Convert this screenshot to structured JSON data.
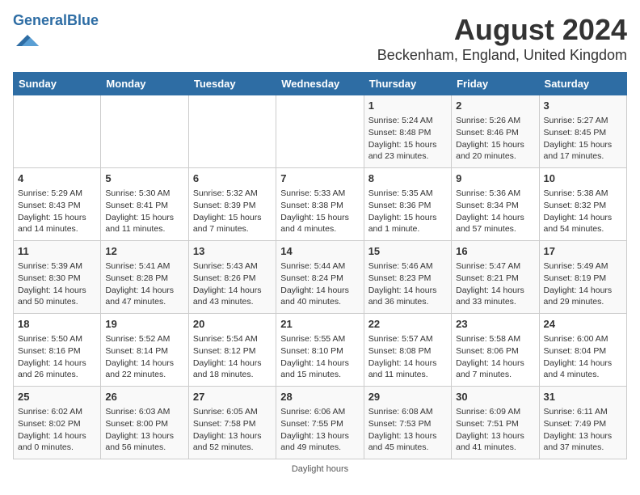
{
  "header": {
    "logo_general": "General",
    "logo_blue": "Blue",
    "main_title": "August 2024",
    "subtitle": "Beckenham, England, United Kingdom"
  },
  "columns": [
    "Sunday",
    "Monday",
    "Tuesday",
    "Wednesday",
    "Thursday",
    "Friday",
    "Saturday"
  ],
  "weeks": [
    [
      {
        "day": "",
        "info": ""
      },
      {
        "day": "",
        "info": ""
      },
      {
        "day": "",
        "info": ""
      },
      {
        "day": "",
        "info": ""
      },
      {
        "day": "1",
        "info": "Sunrise: 5:24 AM\nSunset: 8:48 PM\nDaylight: 15 hours\nand 23 minutes."
      },
      {
        "day": "2",
        "info": "Sunrise: 5:26 AM\nSunset: 8:46 PM\nDaylight: 15 hours\nand 20 minutes."
      },
      {
        "day": "3",
        "info": "Sunrise: 5:27 AM\nSunset: 8:45 PM\nDaylight: 15 hours\nand 17 minutes."
      }
    ],
    [
      {
        "day": "4",
        "info": "Sunrise: 5:29 AM\nSunset: 8:43 PM\nDaylight: 15 hours\nand 14 minutes."
      },
      {
        "day": "5",
        "info": "Sunrise: 5:30 AM\nSunset: 8:41 PM\nDaylight: 15 hours\nand 11 minutes."
      },
      {
        "day": "6",
        "info": "Sunrise: 5:32 AM\nSunset: 8:39 PM\nDaylight: 15 hours\nand 7 minutes."
      },
      {
        "day": "7",
        "info": "Sunrise: 5:33 AM\nSunset: 8:38 PM\nDaylight: 15 hours\nand 4 minutes."
      },
      {
        "day": "8",
        "info": "Sunrise: 5:35 AM\nSunset: 8:36 PM\nDaylight: 15 hours\nand 1 minute."
      },
      {
        "day": "9",
        "info": "Sunrise: 5:36 AM\nSunset: 8:34 PM\nDaylight: 14 hours\nand 57 minutes."
      },
      {
        "day": "10",
        "info": "Sunrise: 5:38 AM\nSunset: 8:32 PM\nDaylight: 14 hours\nand 54 minutes."
      }
    ],
    [
      {
        "day": "11",
        "info": "Sunrise: 5:39 AM\nSunset: 8:30 PM\nDaylight: 14 hours\nand 50 minutes."
      },
      {
        "day": "12",
        "info": "Sunrise: 5:41 AM\nSunset: 8:28 PM\nDaylight: 14 hours\nand 47 minutes."
      },
      {
        "day": "13",
        "info": "Sunrise: 5:43 AM\nSunset: 8:26 PM\nDaylight: 14 hours\nand 43 minutes."
      },
      {
        "day": "14",
        "info": "Sunrise: 5:44 AM\nSunset: 8:24 PM\nDaylight: 14 hours\nand 40 minutes."
      },
      {
        "day": "15",
        "info": "Sunrise: 5:46 AM\nSunset: 8:23 PM\nDaylight: 14 hours\nand 36 minutes."
      },
      {
        "day": "16",
        "info": "Sunrise: 5:47 AM\nSunset: 8:21 PM\nDaylight: 14 hours\nand 33 minutes."
      },
      {
        "day": "17",
        "info": "Sunrise: 5:49 AM\nSunset: 8:19 PM\nDaylight: 14 hours\nand 29 minutes."
      }
    ],
    [
      {
        "day": "18",
        "info": "Sunrise: 5:50 AM\nSunset: 8:16 PM\nDaylight: 14 hours\nand 26 minutes."
      },
      {
        "day": "19",
        "info": "Sunrise: 5:52 AM\nSunset: 8:14 PM\nDaylight: 14 hours\nand 22 minutes."
      },
      {
        "day": "20",
        "info": "Sunrise: 5:54 AM\nSunset: 8:12 PM\nDaylight: 14 hours\nand 18 minutes."
      },
      {
        "day": "21",
        "info": "Sunrise: 5:55 AM\nSunset: 8:10 PM\nDaylight: 14 hours\nand 15 minutes."
      },
      {
        "day": "22",
        "info": "Sunrise: 5:57 AM\nSunset: 8:08 PM\nDaylight: 14 hours\nand 11 minutes."
      },
      {
        "day": "23",
        "info": "Sunrise: 5:58 AM\nSunset: 8:06 PM\nDaylight: 14 hours\nand 7 minutes."
      },
      {
        "day": "24",
        "info": "Sunrise: 6:00 AM\nSunset: 8:04 PM\nDaylight: 14 hours\nand 4 minutes."
      }
    ],
    [
      {
        "day": "25",
        "info": "Sunrise: 6:02 AM\nSunset: 8:02 PM\nDaylight: 14 hours\nand 0 minutes."
      },
      {
        "day": "26",
        "info": "Sunrise: 6:03 AM\nSunset: 8:00 PM\nDaylight: 13 hours\nand 56 minutes."
      },
      {
        "day": "27",
        "info": "Sunrise: 6:05 AM\nSunset: 7:58 PM\nDaylight: 13 hours\nand 52 minutes."
      },
      {
        "day": "28",
        "info": "Sunrise: 6:06 AM\nSunset: 7:55 PM\nDaylight: 13 hours\nand 49 minutes."
      },
      {
        "day": "29",
        "info": "Sunrise: 6:08 AM\nSunset: 7:53 PM\nDaylight: 13 hours\nand 45 minutes."
      },
      {
        "day": "30",
        "info": "Sunrise: 6:09 AM\nSunset: 7:51 PM\nDaylight: 13 hours\nand 41 minutes."
      },
      {
        "day": "31",
        "info": "Sunrise: 6:11 AM\nSunset: 7:49 PM\nDaylight: 13 hours\nand 37 minutes."
      }
    ]
  ],
  "footer": {
    "note": "Daylight hours"
  }
}
